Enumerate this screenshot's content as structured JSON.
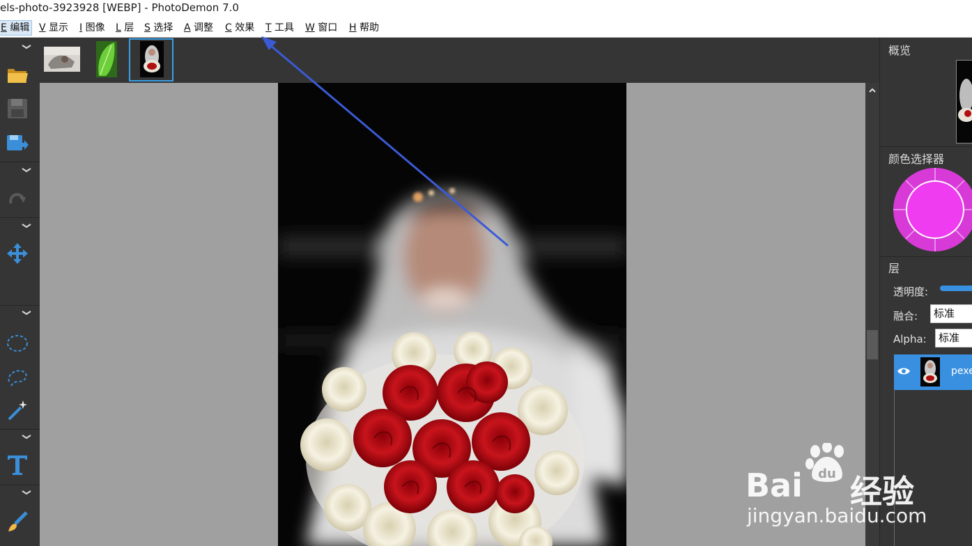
{
  "window": {
    "title": "els-photo-3923928 [WEBP]  -  PhotoDemon 7.0"
  },
  "menu": {
    "items": [
      {
        "key": "E",
        "label": "编辑"
      },
      {
        "key": "V",
        "label": "显示"
      },
      {
        "key": "I",
        "label": "图像"
      },
      {
        "key": "L",
        "label": "层"
      },
      {
        "key": "S",
        "label": "选择"
      },
      {
        "key": "A",
        "label": "调整"
      },
      {
        "key": "C",
        "label": "效果"
      },
      {
        "key": "T",
        "label": "工具"
      },
      {
        "key": "W",
        "label": "窗口"
      },
      {
        "key": "H",
        "label": "帮助"
      }
    ]
  },
  "toolbar": {
    "icons": [
      "open-folder-icon",
      "save-icon",
      "save-as-icon",
      "redo-icon",
      "move-icon",
      "ellipse-select-icon",
      "lasso-select-icon",
      "magic-wand-icon",
      "text-tool-icon",
      "paintbrush-icon"
    ]
  },
  "thumbnails": [
    {
      "name": "image-tab-1",
      "selected": false
    },
    {
      "name": "image-tab-2",
      "selected": false
    },
    {
      "name": "image-tab-3",
      "selected": true
    }
  ],
  "panels": {
    "overview_title": "概览",
    "color_picker_title": "颜色选择器",
    "current_color": "#f03cf0",
    "layers_title": "层"
  },
  "layers": {
    "opacity_label": "透明度:",
    "blend_label": "融合:",
    "blend_value": "标准",
    "alpha_label": "Alpha:",
    "alpha_value": "标准",
    "layer_name": "pexe"
  },
  "watermark": {
    "brand": "Bai",
    "brand2": "du",
    "cn": "经验",
    "url": "jingyan.baidu.com"
  },
  "colors": {
    "accent": "#3a90e0",
    "annotation_arrow": "#3b5bd6"
  }
}
